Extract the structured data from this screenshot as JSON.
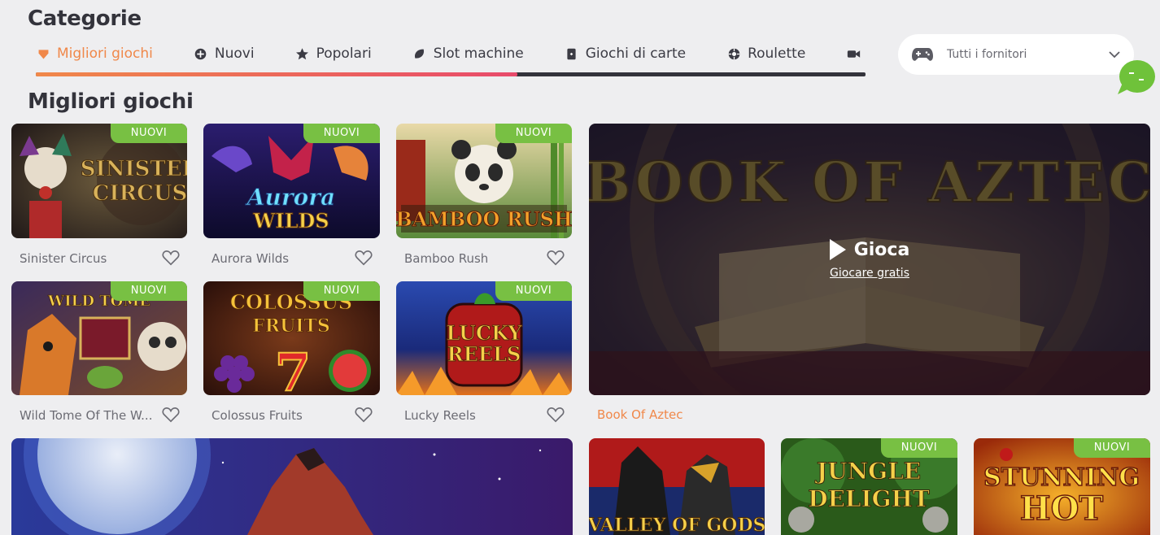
{
  "header": {
    "title": "Categorie",
    "subtitle": "Migliori giochi"
  },
  "tabs": [
    {
      "label": "Migliori giochi",
      "icon": "heart-icon",
      "active": true
    },
    {
      "label": "Nuovi",
      "icon": "plus-circle-icon",
      "active": false
    },
    {
      "label": "Popolari",
      "icon": "star-icon",
      "active": false
    },
    {
      "label": "Slot machine",
      "icon": "slot-icon",
      "active": false
    },
    {
      "label": "Giochi di carte",
      "icon": "card-icon",
      "active": false
    },
    {
      "label": "Roulette",
      "icon": "roulette-icon",
      "active": false
    },
    {
      "label": "",
      "icon": "video-camera-icon",
      "active": false
    }
  ],
  "tabs_scroll_progress": 0.58,
  "provider_select": {
    "value": "Tutti i fornitori",
    "icon": "gamepad-icon"
  },
  "badge_label": "NUOVI",
  "games": [
    {
      "name": "Sinister Circus",
      "art": "SINISTER CIRCUS",
      "new": true
    },
    {
      "name": "Aurora Wilds",
      "art": "Aurora WILDS",
      "new": true
    },
    {
      "name": "Bamboo Rush",
      "art": "BAMBOO RUSH",
      "new": true
    },
    {
      "name": "Wild Tome Of The Woods",
      "name_display": "Wild Tome Of The W...",
      "art": "WILD TOME",
      "new": true
    },
    {
      "name": "Colossus Fruits",
      "art": "COLOSSUS FRUITS",
      "new": true
    },
    {
      "name": "Lucky Reels",
      "art": "LUCKY REELS",
      "new": true
    }
  ],
  "featured": {
    "name": "Book Of Aztec",
    "art": "BOOK OF AZTEC",
    "play_label": "Gioca",
    "free_label": "Giocare gratis"
  },
  "bottom_games": [
    {
      "name": "Valley of Gods",
      "art": "VALLEY OF GODS",
      "new": false
    },
    {
      "name": "Jungle Delight",
      "art": "JUNGLE DELIGHT",
      "new": true
    },
    {
      "name": "Stunning Hot",
      "art": "STUNNING HOT",
      "new": true
    }
  ],
  "colors": {
    "accent": "#f0884a",
    "badge": "#78c043",
    "background": "#eeeef0"
  }
}
